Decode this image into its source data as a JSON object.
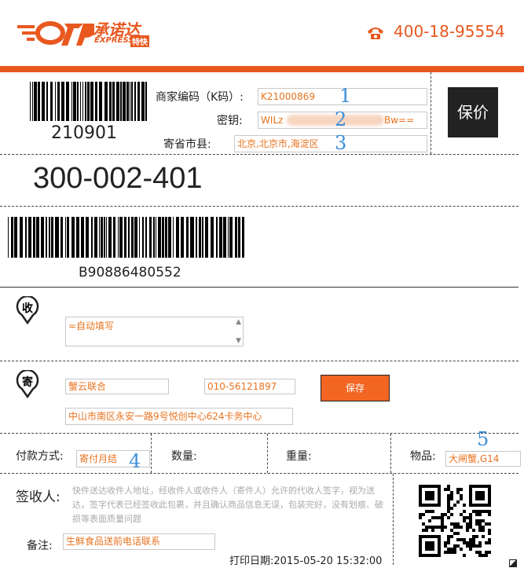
{
  "header": {
    "logo_brand": "承诺达",
    "logo_sub": "EXPRESS",
    "logo_sub2": "特快",
    "phone": "400-18-95554"
  },
  "merchant": {
    "barcode_number": "210901",
    "code_label": "商家编码（K码）:",
    "code_value": "K21000869",
    "key_label": "密钥:",
    "key_value_start": "WILz",
    "key_value_end": "Bw==",
    "region_label": "寄省市县:",
    "region_value": "北京,北京市,海淀区",
    "insure_button": "保价"
  },
  "tracking": {
    "code": "300-002-401",
    "barcode_number": "B90886480552"
  },
  "receiver": {
    "icon_char": "收",
    "auto_fill_text": "=自动填写"
  },
  "sender": {
    "icon_char": "寄",
    "name": "蟹云联合",
    "phone": "010-56121897",
    "save_button": "保存",
    "address": "中山市南区永安一路9号悦创中心624卡务中心"
  },
  "details": {
    "payment_label": "付款方式:",
    "payment_value": "寄付月结",
    "quantity_label": "数量:",
    "weight_label": "重量:",
    "item_label": "物品:",
    "item_value": "大闸蟹,G14"
  },
  "signature": {
    "label": "签收人:",
    "terms": "快件送达收件人地址，经收件人或收件人（寄件人）允许的代收人签字，视为送达，签字代表已经签收此包裹，并且确认商品信息无误，包装完好，没有划痕、破损等表面质量问题",
    "remark_label": "备注:",
    "remark_value": "生鲜食品送前电话联系",
    "print_date": "打印日期:2015-05-20 15:32:00"
  },
  "annotations": [
    "1",
    "2",
    "3",
    "4",
    "5"
  ],
  "colors": {
    "accent": "#e8581f",
    "button": "#f26522",
    "annotation": "#3b8ed8"
  }
}
